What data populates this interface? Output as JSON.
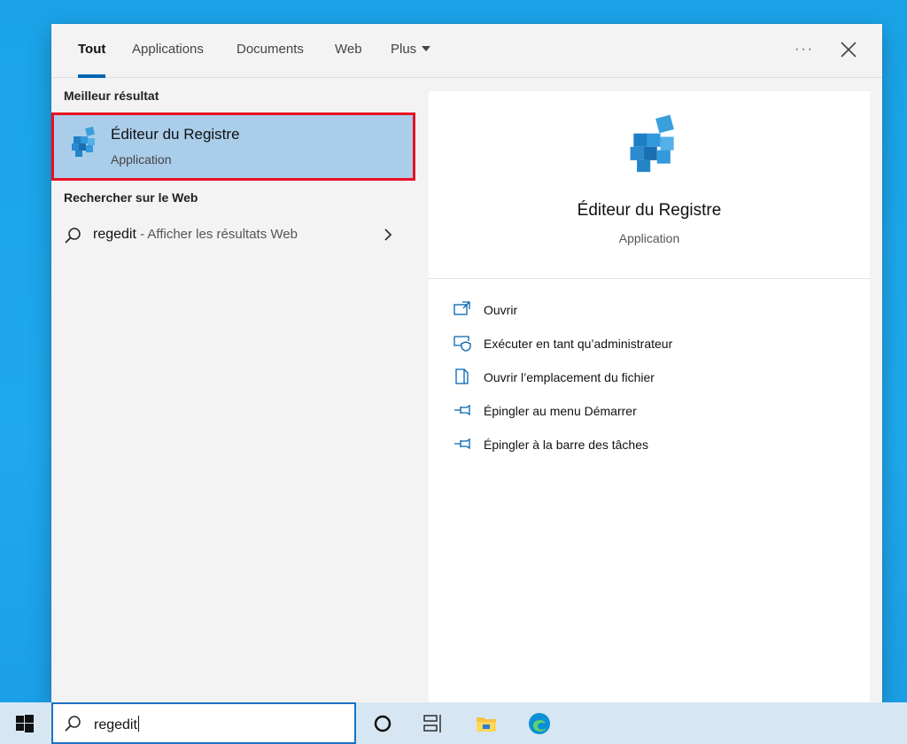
{
  "tabs": [
    {
      "label": "Tout",
      "active": true
    },
    {
      "label": "Applications"
    },
    {
      "label": "Documents"
    },
    {
      "label": "Web"
    },
    {
      "label": "Plus"
    }
  ],
  "header": {
    "more_label": "···",
    "more_icon": "ellipsis-icon",
    "close_icon": "close-icon"
  },
  "left": {
    "best_heading": "Meilleur résultat",
    "best": {
      "title": "Éditeur du Registre",
      "subtitle": "Application",
      "icon": "registry-editor-icon"
    },
    "web_heading": "Rechercher sur le Web",
    "web": {
      "query": "regedit",
      "suffix": " - Afficher les résultats Web",
      "icon": "search-icon",
      "arrow_icon": "chevron-right-icon"
    }
  },
  "right": {
    "title": "Éditeur du Registre",
    "subtitle": "Application",
    "actions": [
      {
        "label": "Ouvrir",
        "icon": "open-icon"
      },
      {
        "label": "Exécuter en tant qu’administrateur",
        "icon": "run-as-admin-icon"
      },
      {
        "label": "Ouvrir l’emplacement du fichier",
        "icon": "file-location-icon"
      },
      {
        "label": "Épingler au menu Démarrer",
        "icon": "pin-icon"
      },
      {
        "label": "Épingler à la barre des tâches",
        "icon": "pin-icon"
      }
    ]
  },
  "taskbar": {
    "search_value": "regedit",
    "icons": [
      "windows-start-icon",
      "cortana-icon",
      "task-view-icon",
      "file-explorer-icon",
      "edge-icon"
    ]
  },
  "colors": {
    "accent": "#0063b1",
    "selected_bg": "#aacdea",
    "highlight_border": "#e81123",
    "desktop": "#1aa3e8"
  }
}
